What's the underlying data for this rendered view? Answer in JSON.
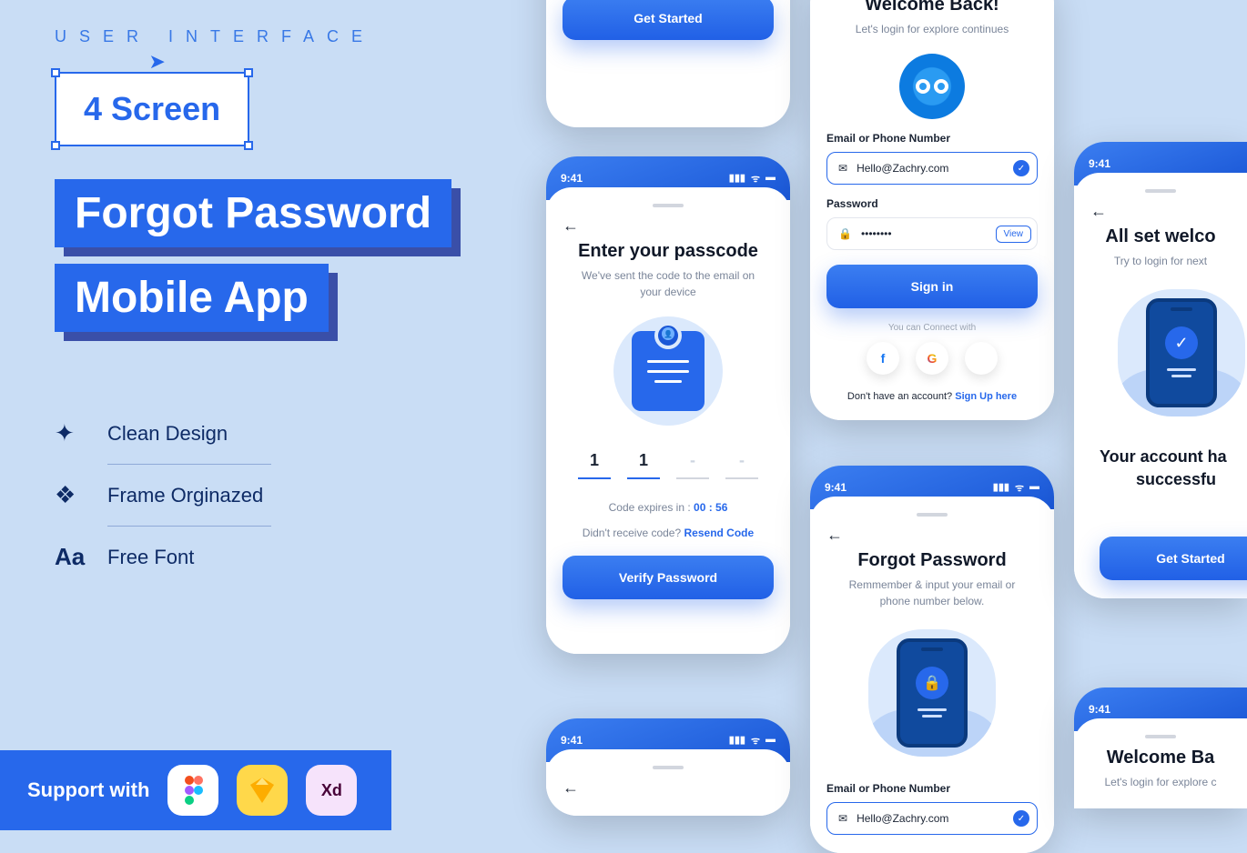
{
  "promo": {
    "kicker": "USER INTERFACE",
    "badge": "4 Screen",
    "title1": "Forgot Password",
    "title2": "Mobile App",
    "features": [
      "Clean Design",
      "Frame Orginazed",
      "Free Font"
    ],
    "support_label": "Support with",
    "tools": {
      "xd": "Xd"
    }
  },
  "status": {
    "time": "9:41"
  },
  "screen_getstarted": {
    "button": "Get Started"
  },
  "screen_passcode": {
    "title": "Enter your passcode",
    "subtitle": "We've sent the code to the email on your device",
    "code": [
      "1",
      "1",
      "-",
      "-"
    ],
    "expires_prefix": "Code expires in :",
    "expires_time": "00 : 56",
    "resend_prefix": "Didn't receive code?",
    "resend_link": "Resend Code",
    "button": "Verify Password"
  },
  "screen_welcome": {
    "title": "Welcome Back!",
    "subtitle": "Let's login for explore continues",
    "email_label": "Email or Phone Number",
    "email_value": "Hello@Zachry.com",
    "password_label": "Password",
    "password_value": "••••••••",
    "view_label": "View",
    "signin": "Sign in",
    "connect": "You can Connect with",
    "signup_prefix": "Don't have an account?",
    "signup_link": "Sign Up here"
  },
  "screen_forgot": {
    "title": "Forgot Password",
    "subtitle": "Remmember & input your email or phone number below.",
    "email_label": "Email or Phone Number",
    "email_value": "Hello@Zachry.com"
  },
  "screen_success": {
    "title": "All set welco",
    "subtitle": "Try to login for next",
    "message_line1": "Your account ha",
    "message_line2": "successfu",
    "button": "Get Started"
  },
  "screen_welcome2": {
    "title": "Welcome Ba",
    "subtitle": "Let's login for explore c"
  }
}
